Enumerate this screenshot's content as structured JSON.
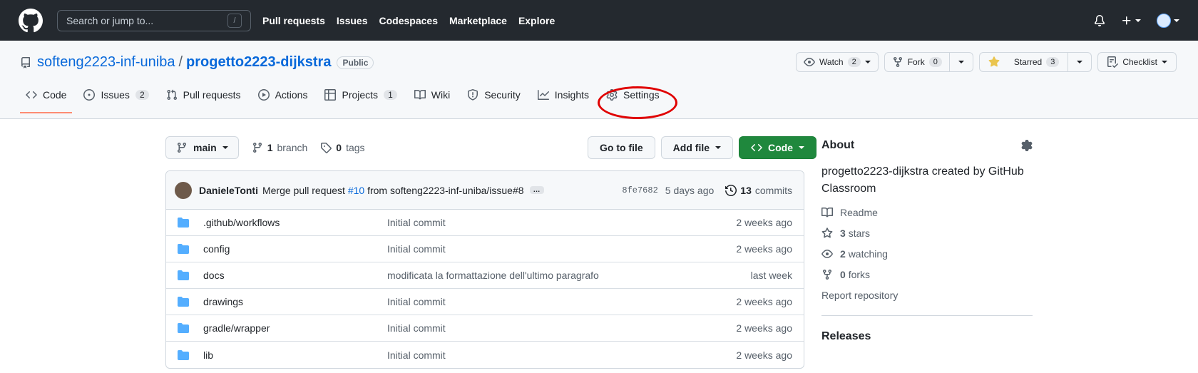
{
  "header": {
    "search_placeholder": "Search or jump to...",
    "search_key": "/",
    "nav": [
      "Pull requests",
      "Issues",
      "Codespaces",
      "Marketplace",
      "Explore"
    ]
  },
  "repo": {
    "owner": "softeng2223-inf-uniba",
    "separator": "/",
    "name": "progetto2223-dijkstra",
    "visibility": "Public",
    "watch_label": "Watch",
    "watch_count": "2",
    "fork_label": "Fork",
    "fork_count": "0",
    "star_label": "Starred",
    "star_count": "3",
    "list_label": "Checklist"
  },
  "tabs": [
    {
      "label": "Code",
      "counter": ""
    },
    {
      "label": "Issues",
      "counter": "2"
    },
    {
      "label": "Pull requests",
      "counter": ""
    },
    {
      "label": "Actions",
      "counter": ""
    },
    {
      "label": "Projects",
      "counter": "1"
    },
    {
      "label": "Wiki",
      "counter": ""
    },
    {
      "label": "Security",
      "counter": ""
    },
    {
      "label": "Insights",
      "counter": ""
    },
    {
      "label": "Settings",
      "counter": ""
    }
  ],
  "branchbar": {
    "branch": "main",
    "branch_count": "1",
    "branch_label": "branch",
    "tag_count": "0",
    "tag_label": "tags",
    "goto_file": "Go to file",
    "add_file": "Add file",
    "code": "Code"
  },
  "commit": {
    "author": "DanieleTonti",
    "message_prefix": "Merge pull request",
    "pr": "#10",
    "message_suffix": "from softeng2223-inf-uniba/issue#8",
    "ellipsis": "…",
    "sha": "8fe7682",
    "time": "5 days ago",
    "count": "13",
    "count_label": "commits"
  },
  "files": [
    {
      "name": ".github/workflows",
      "message": "Initial commit",
      "date": "2 weeks ago"
    },
    {
      "name": "config",
      "message": "Initial commit",
      "date": "2 weeks ago"
    },
    {
      "name": "docs",
      "message": "modificata la formattazione dell'ultimo paragrafo",
      "date": "last week"
    },
    {
      "name": "drawings",
      "message": "Initial commit",
      "date": "2 weeks ago"
    },
    {
      "name": "gradle/wrapper",
      "message": "Initial commit",
      "date": "2 weeks ago"
    },
    {
      "name": "lib",
      "message": "Initial commit",
      "date": "2 weeks ago"
    }
  ],
  "about": {
    "title": "About",
    "description": "progetto2223-dijkstra created by GitHub Classroom",
    "readme": "Readme",
    "stars_count": "3",
    "stars_label": "stars",
    "watching_count": "2",
    "watching_label": "watching",
    "forks_count": "0",
    "forks_label": "forks",
    "report": "Report repository",
    "releases": "Releases"
  },
  "colors": {
    "header_bg": "#24292f",
    "link": "#0969da",
    "green_button": "#1f883d",
    "folder": "#54aeff",
    "annotation_ring": "#e00000"
  }
}
